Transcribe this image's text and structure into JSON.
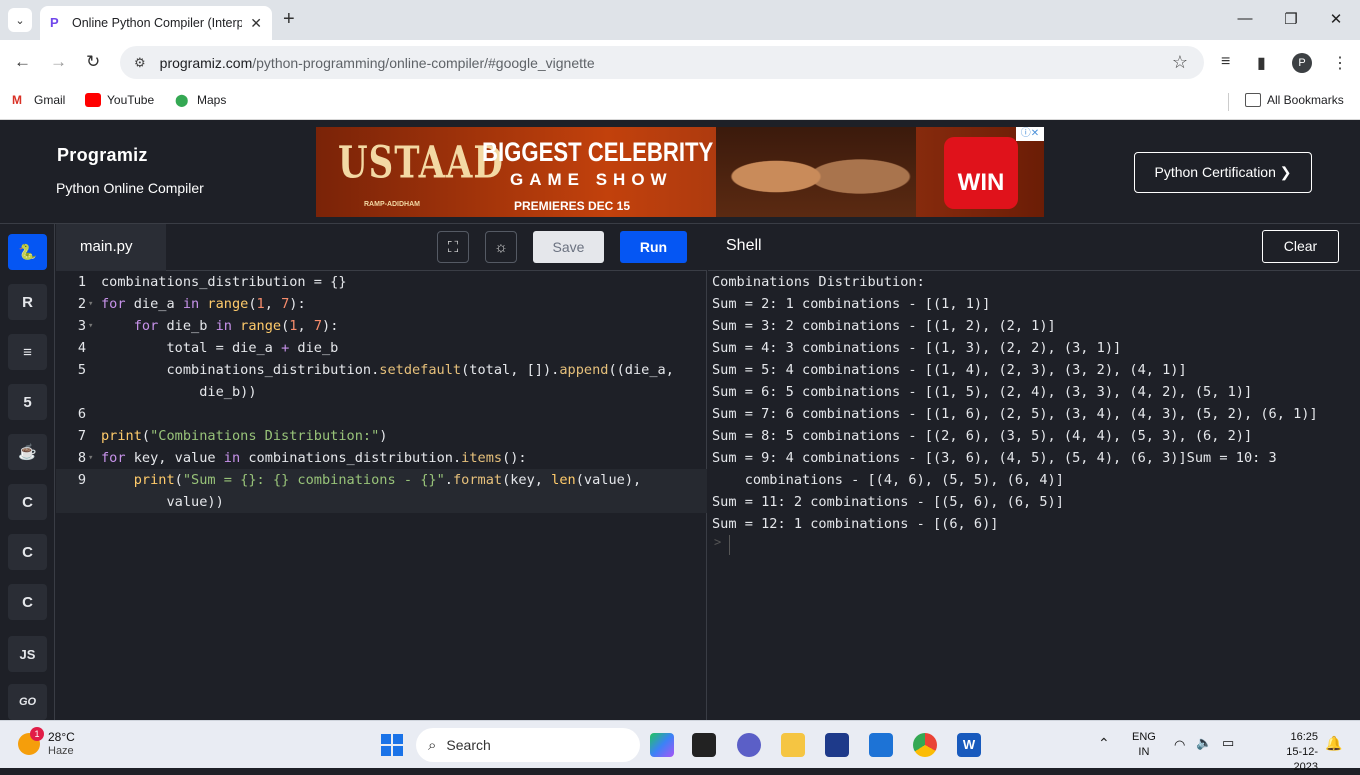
{
  "browser": {
    "tab_title": "Online Python Compiler (Interp",
    "url_host": "programiz.com",
    "url_path": "/python-programming/online-compiler/#google_vignette",
    "profile_initial": "P",
    "bookmarks": [
      "Gmail",
      "YouTube",
      "Maps"
    ],
    "all_bookmarks": "All Bookmarks"
  },
  "site": {
    "logo": "Programiz",
    "subtitle": "Python Online Compiler",
    "cert_button": "Python Certification ❯",
    "ad": {
      "brand": "USTAAD",
      "brand_sub": "RAMP-ADIDHAM",
      "headline": "BIGGEST CELEBRITY",
      "subheadline": "GAME SHOW",
      "date": "PREMIERES DEC 15",
      "logo": "WIN"
    }
  },
  "sidebar": {
    "langs": [
      {
        "name": "python",
        "glyph": "🐍"
      },
      {
        "name": "r",
        "glyph": "R"
      },
      {
        "name": "sql",
        "glyph": "≡"
      },
      {
        "name": "html",
        "glyph": "5"
      },
      {
        "name": "java",
        "glyph": "☕"
      },
      {
        "name": "c",
        "glyph": "C"
      },
      {
        "name": "cpp",
        "glyph": "C"
      },
      {
        "name": "csharp",
        "glyph": "C"
      },
      {
        "name": "js",
        "glyph": "JS"
      },
      {
        "name": "go",
        "glyph": "GO"
      }
    ]
  },
  "editor": {
    "filename": "main.py",
    "save_label": "Save",
    "run_label": "Run"
  },
  "shell": {
    "title": "Shell",
    "clear_label": "Clear",
    "prompt": ">",
    "output": [
      "Combinations Distribution:",
      "Sum = 2: 1 combinations - [(1, 1)]",
      "Sum = 3: 2 combinations - [(1, 2), (2, 1)]",
      "Sum = 4: 3 combinations - [(1, 3), (2, 2), (3, 1)]",
      "Sum = 5: 4 combinations - [(1, 4), (2, 3), (3, 2), (4, 1)]",
      "Sum = 6: 5 combinations - [(1, 5), (2, 4), (3, 3), (4, 2), (5, 1)]",
      "Sum = 7: 6 combinations - [(1, 6), (2, 5), (3, 4), (4, 3), (5, 2), (6, 1)]",
      "Sum = 8: 5 combinations - [(2, 6), (3, 5), (4, 4), (5, 3), (6, 2)]",
      "Sum = 9: 4 combinations - [(3, 6), (4, 5), (5, 4), (6, 3)]Sum = 10: 3",
      "    combinations - [(4, 6), (5, 5), (6, 4)]",
      "Sum = 11: 2 combinations - [(5, 6), (6, 5)]",
      "Sum = 12: 1 combinations - [(6, 6)]"
    ]
  },
  "taskbar": {
    "temp": "28°C",
    "weather": "Haze",
    "weather_badge": "1",
    "search_placeholder": "Search",
    "lang_top": "ENG",
    "lang_bottom": "IN",
    "time": "16:25",
    "date": "15-12-2023"
  }
}
